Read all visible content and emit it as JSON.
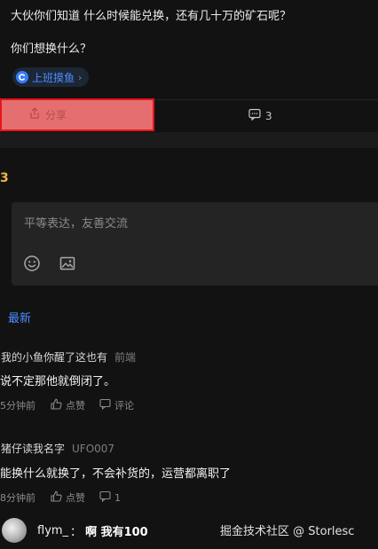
{
  "post": {
    "line1": "大伙你们知道 什么时候能兑换，还有几十万的矿石呢？",
    "line2": "你们想换什么？",
    "topic": "上班摸鱼",
    "topic_icon": "topic-c-icon",
    "topic_chevron": "›"
  },
  "actions": {
    "share_label": "分享",
    "comment_count": "3"
  },
  "heading_fragment": "3",
  "editor": {
    "placeholder": "平等表达，友善交流"
  },
  "sort": {
    "latest_label": "最新"
  },
  "comments": [
    {
      "author": "我的小鱼你醒了这也有",
      "title": "前端",
      "body": "说不定那他就倒闭了。",
      "time": "5分钟前",
      "like_label": "点赞",
      "reply_label": "评论"
    },
    {
      "author": "猪仔读我名字",
      "title": "UFO007",
      "body": "能换什么就换了，不会补货的，运营都离职了",
      "time": "8分钟前",
      "like_label": "点赞",
      "reply_label": "1"
    }
  ],
  "danmaku": {
    "user": "flym_",
    "separator": "：",
    "message": "啊 我有100"
  },
  "watermark": "掘金技术社区 @ Storlesc",
  "colors": {
    "background": "#121212",
    "accent_blue": "#4c8dff",
    "share_highlight": "#e56f70",
    "share_border": "#e8141a",
    "heading_gold": "#f0b540"
  }
}
